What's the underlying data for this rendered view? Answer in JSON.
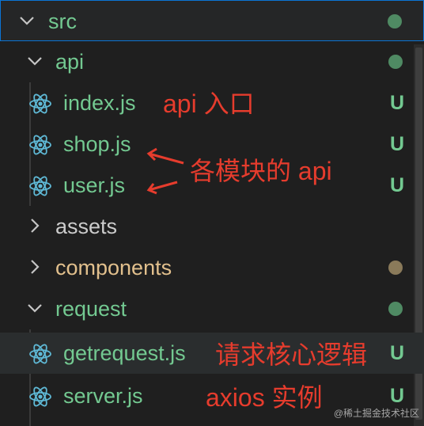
{
  "tree": {
    "src": {
      "label": "src"
    },
    "api": {
      "label": "api"
    },
    "index_js": {
      "label": "index.js",
      "status": "U"
    },
    "shop_js": {
      "label": "shop.js",
      "status": "U"
    },
    "user_js": {
      "label": "user.js",
      "status": "U"
    },
    "assets": {
      "label": "assets"
    },
    "components": {
      "label": "components"
    },
    "request": {
      "label": "request"
    },
    "getrequest_js": {
      "label": "getrequest.js",
      "status": "U"
    },
    "server_js": {
      "label": "server.js",
      "status": "U"
    }
  },
  "annotations": {
    "index_note": "api 入口",
    "modules_note": "各模块的 api",
    "getrequest_note": "请求核心逻辑",
    "server_note": "axios 实例"
  },
  "watermark": "@稀土掘金技术社区",
  "icons": {
    "chevron_open": "chevron-down-icon",
    "chevron_closed": "chevron-right-icon",
    "file_type": "react-icon"
  },
  "colors": {
    "background": "#1f1f1f",
    "untracked_green": "#73c991",
    "modified_folder": "#e2c08d",
    "annotation_red": "#e63c2d",
    "focus_border": "#0b74d4"
  }
}
